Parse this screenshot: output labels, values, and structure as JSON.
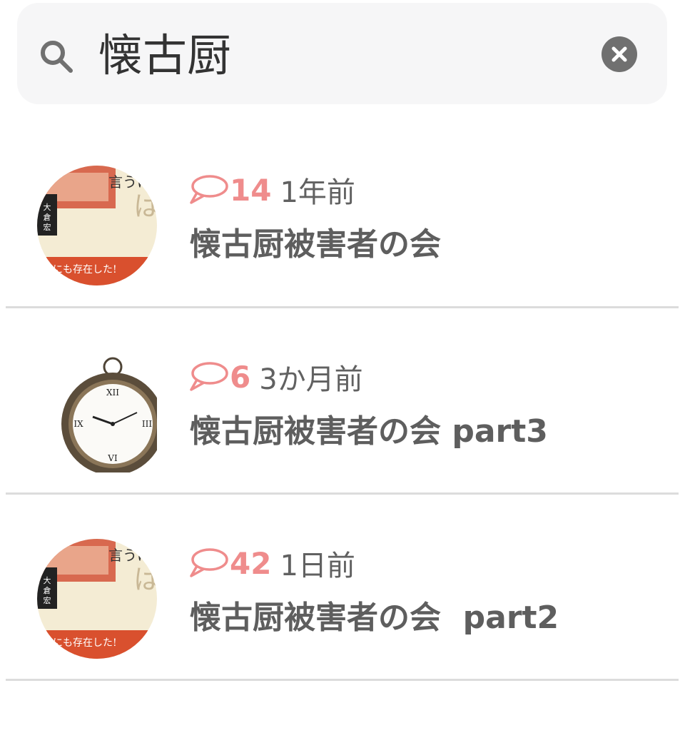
{
  "search": {
    "query": "懐古厨"
  },
  "colors": {
    "count_pink": "#ef8c8c",
    "search_bg": "#f6f6f7",
    "clear_button": "#707070"
  },
  "results": [
    {
      "thumbnail": "book-cover-image",
      "comment_count": "14",
      "time_ago": "1年前",
      "title": "懐古厨被害者の会"
    },
    {
      "thumbnail": "pocket-watch-image",
      "comment_count": "6",
      "time_ago": "3か月前",
      "title": "懐古厨被害者の会 part3"
    },
    {
      "thumbnail": "book-cover-image",
      "comment_count": "42",
      "time_ago": "1日前",
      "title": "懐古厨被害者の会  part2"
    }
  ]
}
